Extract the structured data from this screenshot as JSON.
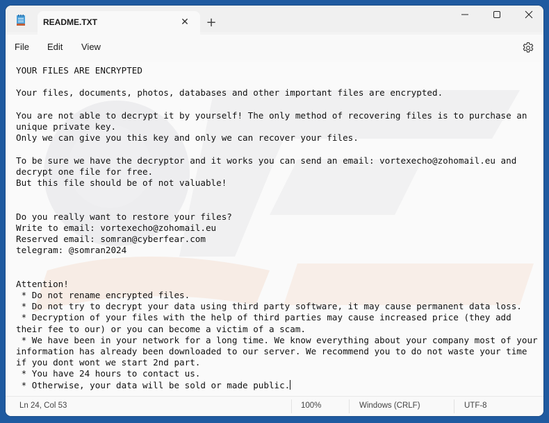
{
  "window": {
    "tab_title": "README.TXT",
    "new_tab_label": "+",
    "close_tab_glyph": "✕",
    "minimize_glyph": "—",
    "maximize_glyph": "☐",
    "close_glyph": "✕"
  },
  "menu": {
    "file": "File",
    "edit": "Edit",
    "view": "View"
  },
  "document": {
    "lines": [
      "YOUR FILES ARE ENCRYPTED",
      "",
      "Your files, documents, photos, databases and other important files are encrypted.",
      "",
      "You are not able to decrypt it by yourself! The only method of recovering files is to purchase an",
      "unique private key.",
      "Only we can give you this key and only we can recover your files.",
      "",
      "To be sure we have the decryptor and it works you can send an email: vortexecho@zohomail.eu and",
      "decrypt one file for free.",
      "But this file should be of not valuable!",
      "",
      "",
      "Do you really want to restore your files?",
      "Write to email: vortexecho@zohomail.eu",
      "Reserved email: somran@cyberfear.com",
      "telegram: @somran2024",
      "",
      "",
      "Attention!",
      " * Do not rename encrypted files.",
      " * Do not try to decrypt your data using third party software, it may cause permanent data loss.",
      " * Decryption of your files with the help of third parties may cause increased price (they add",
      "their fee to our) or you can become a victim of a scam.",
      " * We have been in your network for a long time. We know everything about your company most of your",
      "information has already been downloaded to our server. We recommend you to do not waste your time",
      "if you dont wont we start 2nd part.",
      " * You have 24 hours to contact us.",
      " * Otherwise, your data will be sold or made public."
    ]
  },
  "status": {
    "position": "Ln 24, Col 53",
    "zoom": "100%",
    "line_ending": "Windows (CRLF)",
    "encoding": "UTF-8"
  },
  "colors": {
    "desktop": "#1f5aa0",
    "accent": "#0067c0"
  }
}
